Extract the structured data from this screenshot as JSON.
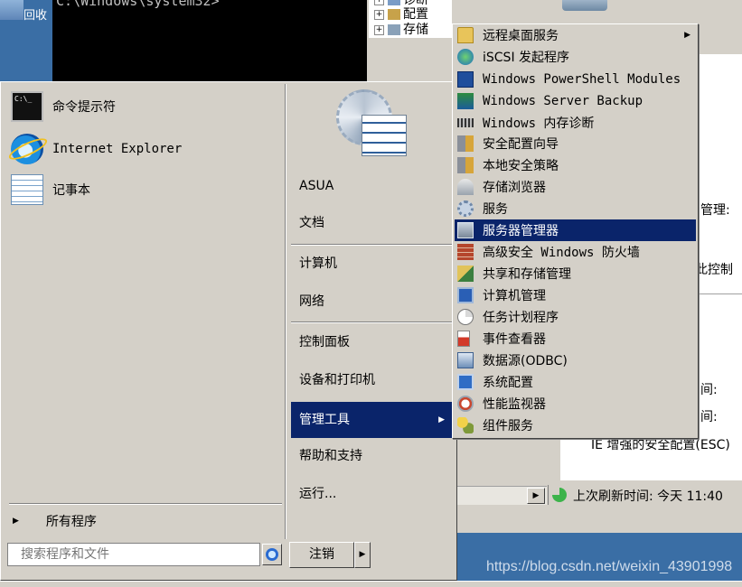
{
  "background": {
    "desktop_icon_label": "回收",
    "console_text": "C:\\Windows\\system32>",
    "tree_items": [
      "诊断",
      "配置",
      "存储"
    ],
    "server_manager_fragments": {
      "management_label": "管理:",
      "this_control": "此控制",
      "time_1": "间:",
      "time_2": "间:",
      "ie_esc": "IE 增强的安全配置(ESC)",
      "last_refresh": "上次刷新时间: 今天 11:40"
    },
    "watermark": "https://blog.csdn.net/weixin_43901998"
  },
  "start_menu": {
    "pinned": [
      {
        "label": "命令提示符",
        "icon": "command-prompt-icon"
      },
      {
        "label": "Internet Explorer",
        "icon": "internet-explorer-icon"
      },
      {
        "label": "记事本",
        "icon": "notepad-icon"
      }
    ],
    "all_programs": "所有程序",
    "search_placeholder": "搜索程序和文件",
    "logoff_label": "注销",
    "right_items": [
      {
        "label": "ASUA"
      },
      {
        "label": "文档"
      },
      {
        "label": "计算机"
      },
      {
        "label": "网络"
      },
      {
        "label": "控制面板"
      },
      {
        "label": "设备和打印机"
      },
      {
        "label": "管理工具",
        "selected": true
      },
      {
        "label": "帮助和支持"
      },
      {
        "label": "运行..."
      }
    ]
  },
  "admin_tools": {
    "items": [
      {
        "label": "远程桌面服务",
        "icon": "folder-icon",
        "submenu": true
      },
      {
        "label": "iSCSI 发起程序",
        "icon": "iscsi-icon"
      },
      {
        "label": "Windows PowerShell Modules",
        "icon": "powershell-icon"
      },
      {
        "label": "Windows Server Backup",
        "icon": "backup-icon"
      },
      {
        "label": "Windows 内存诊断",
        "icon": "memory-icon"
      },
      {
        "label": "安全配置向导",
        "icon": "security-wizard-icon"
      },
      {
        "label": "本地安全策略",
        "icon": "local-policy-icon"
      },
      {
        "label": "存储浏览器",
        "icon": "storage-explorer-icon"
      },
      {
        "label": "服务",
        "icon": "services-icon"
      },
      {
        "label": "服务器管理器",
        "icon": "server-manager-icon",
        "selected": true
      },
      {
        "label": "高级安全 Windows 防火墙",
        "icon": "firewall-icon"
      },
      {
        "label": "共享和存储管理",
        "icon": "share-storage-icon"
      },
      {
        "label": "计算机管理",
        "icon": "computer-management-icon"
      },
      {
        "label": "任务计划程序",
        "icon": "task-scheduler-icon"
      },
      {
        "label": "事件查看器",
        "icon": "event-viewer-icon"
      },
      {
        "label": "数据源(ODBC)",
        "icon": "odbc-icon"
      },
      {
        "label": "系统配置",
        "icon": "system-config-icon"
      },
      {
        "label": "性能监视器",
        "icon": "performance-monitor-icon"
      },
      {
        "label": "组件服务",
        "icon": "component-services-icon"
      }
    ]
  },
  "colors": {
    "selection": "#0a246a",
    "menu_face": "#d4d0c8",
    "desktop": "#3a6ea5"
  }
}
